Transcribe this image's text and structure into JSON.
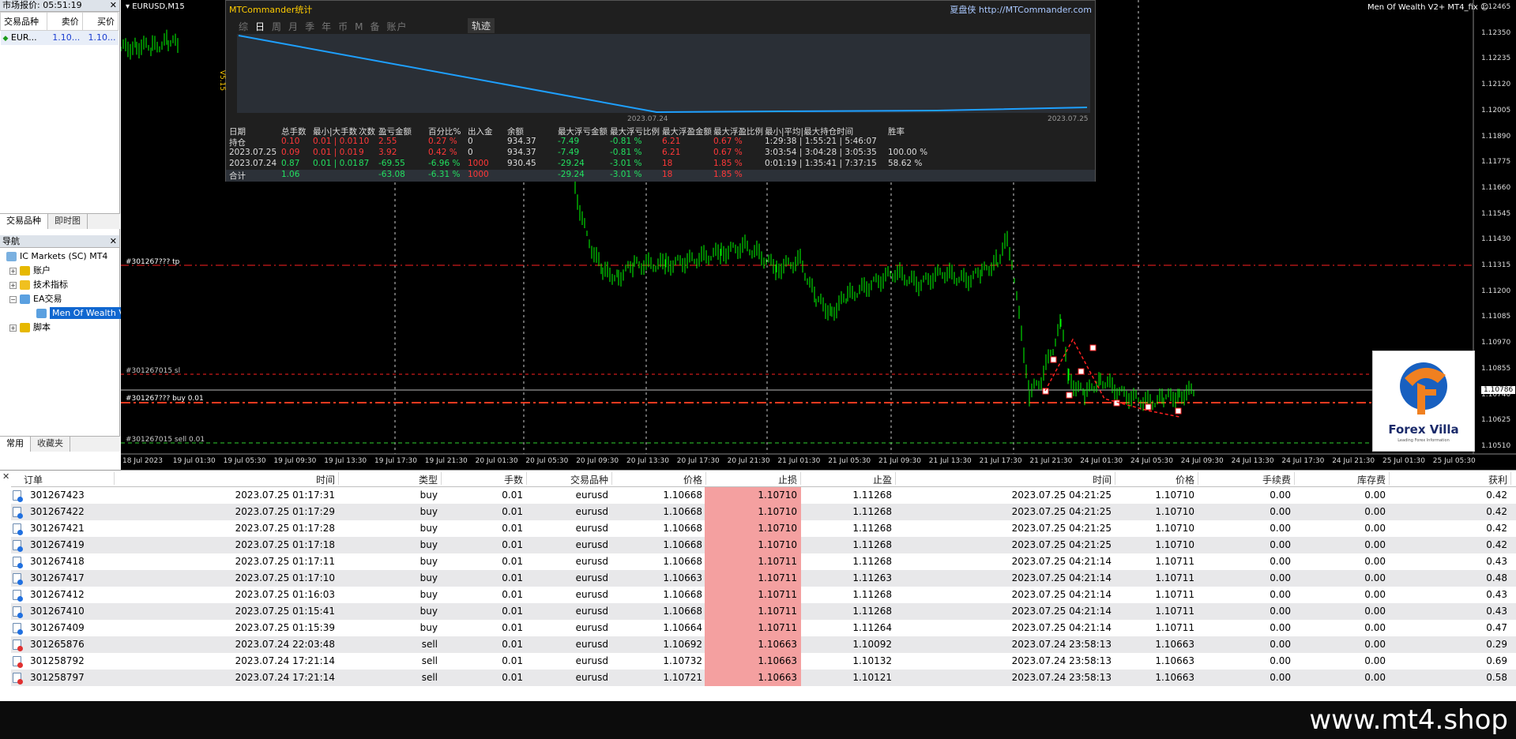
{
  "market_watch": {
    "title": "市场报价: 05:51:19",
    "columns": [
      "交易品种",
      "卖价",
      "买价"
    ],
    "rows": [
      {
        "symbol": "EUR...",
        "bid": "1.10...",
        "ask": "1.10..."
      }
    ],
    "tabs": [
      "交易品种",
      "即时图"
    ]
  },
  "navigator": {
    "title": "导航",
    "items": [
      {
        "label": "IC Markets (SC) MT4"
      },
      {
        "label": "账户"
      },
      {
        "label": "技术指标"
      },
      {
        "label": "EA交易"
      },
      {
        "label": "Men Of Wealth V2"
      },
      {
        "label": "脚本"
      }
    ],
    "tabs": [
      "常用",
      "收藏夹"
    ]
  },
  "chart": {
    "symbol_title": "EURUSD,M15",
    "ea_title": "Men Of Wealth V2+ MT4_fix",
    "line_labels": {
      "tp": "#301267??? tp",
      "sl": "#301267015 sl",
      "buy": "#301267??? buy 0.01",
      "sell": "#301267015 sell 0.01"
    },
    "price_axis": [
      "1.12465",
      "1.12350",
      "1.12235",
      "1.12120",
      "1.12005",
      "1.11890",
      "1.11775",
      "1.11660",
      "1.11545",
      "1.11430",
      "1.11315",
      "1.11200",
      "1.11085",
      "1.10970",
      "1.10855",
      "1.10740",
      "1.10625",
      "1.10510"
    ],
    "current_price": "1.10786",
    "time_axis": [
      "18 Jul 2023",
      "19 Jul 01:30",
      "19 Jul 05:30",
      "19 Jul 09:30",
      "19 Jul 13:30",
      "19 Jul 17:30",
      "19 Jul 21:30",
      "20 Jul 01:30",
      "20 Jul 05:30",
      "20 Jul 09:30",
      "20 Jul 13:30",
      "20 Jul 17:30",
      "20 Jul 21:30",
      "21 Jul 01:30",
      "21 Jul 05:30",
      "21 Jul 09:30",
      "21 Jul 13:30",
      "21 Jul 17:30",
      "21 Jul 21:30",
      "24 Jul 01:30",
      "24 Jul 05:30",
      "24 Jul 09:30",
      "24 Jul 13:30",
      "24 Jul 17:30",
      "24 Jul 21:30",
      "25 Jul 01:30",
      "25 Jul 05:30"
    ]
  },
  "mtc": {
    "title": "MTCommander统计",
    "brand": "夏盘侠 http://MTCommander.com",
    "tabs": [
      "综",
      "日",
      "周",
      "月",
      "季",
      "年",
      "币",
      "M",
      "备",
      "账户"
    ],
    "track": "轨迹",
    "version": "V5.15",
    "date_start": "2023.07.24",
    "date_end": "2023.07.25",
    "headers": [
      "日期",
      "总手数",
      "最小|大手数",
      "次数",
      "盈亏金额",
      "百分比%",
      "出入金",
      "余额",
      "最大浮亏金额",
      "最大浮亏比例",
      "最大浮盈金额",
      "最大浮盈比例",
      "最小|平均|最大持仓时间",
      "胜率"
    ],
    "rows": [
      [
        "持仓",
        "0.10",
        "0.01 | 0.01",
        "10",
        "2.55",
        "0.27 %",
        "0",
        "934.37",
        "-7.49",
        "-0.81 %",
        "6.21",
        "0.67 %",
        "1:29:38 | 1:55:21 | 5:46:07",
        ""
      ],
      [
        "2023.07.25",
        "0.09",
        "0.01 | 0.01",
        "9",
        "3.92",
        "0.42 %",
        "0",
        "934.37",
        "-7.49",
        "-0.81 %",
        "6.21",
        "0.67 %",
        "3:03:54 | 3:04:28 | 3:05:35",
        "100.00 %"
      ],
      [
        "2023.07.24",
        "0.87",
        "0.01 | 0.01",
        "87",
        "-69.55",
        "-6.96 %",
        "1000",
        "930.45",
        "-29.24",
        "-3.01 %",
        "18",
        "1.85 %",
        "0:01:19 | 1:35:41 | 7:37:15",
        "58.62 %"
      ],
      [
        "合计",
        "1.06",
        "",
        "",
        "-63.08",
        "-6.31 %",
        "1000",
        "",
        "-29.24",
        "-3.01 %",
        "18",
        "1.85 %",
        "",
        ""
      ]
    ]
  },
  "terminal": {
    "headers": [
      "订单",
      "时间",
      "类型",
      "手数",
      "交易品种",
      "价格",
      "止损",
      "止盈",
      "时间",
      "价格",
      "手续费",
      "库存费",
      "获利"
    ],
    "rows": [
      [
        "301267423",
        "2023.07.25 01:17:31",
        "buy",
        "0.01",
        "eurusd",
        "1.10668",
        "1.10710",
        "1.11268",
        "2023.07.25 04:21:25",
        "1.10710",
        "0.00",
        "0.00",
        "0.42"
      ],
      [
        "301267422",
        "2023.07.25 01:17:29",
        "buy",
        "0.01",
        "eurusd",
        "1.10668",
        "1.10710",
        "1.11268",
        "2023.07.25 04:21:25",
        "1.10710",
        "0.00",
        "0.00",
        "0.42"
      ],
      [
        "301267421",
        "2023.07.25 01:17:28",
        "buy",
        "0.01",
        "eurusd",
        "1.10668",
        "1.10710",
        "1.11268",
        "2023.07.25 04:21:25",
        "1.10710",
        "0.00",
        "0.00",
        "0.42"
      ],
      [
        "301267419",
        "2023.07.25 01:17:18",
        "buy",
        "0.01",
        "eurusd",
        "1.10668",
        "1.10710",
        "1.11268",
        "2023.07.25 04:21:25",
        "1.10710",
        "0.00",
        "0.00",
        "0.42"
      ],
      [
        "301267418",
        "2023.07.25 01:17:11",
        "buy",
        "0.01",
        "eurusd",
        "1.10668",
        "1.10711",
        "1.11268",
        "2023.07.25 04:21:14",
        "1.10711",
        "0.00",
        "0.00",
        "0.43"
      ],
      [
        "301267417",
        "2023.07.25 01:17:10",
        "buy",
        "0.01",
        "eurusd",
        "1.10663",
        "1.10711",
        "1.11263",
        "2023.07.25 04:21:14",
        "1.10711",
        "0.00",
        "0.00",
        "0.48"
      ],
      [
        "301267412",
        "2023.07.25 01:16:03",
        "buy",
        "0.01",
        "eurusd",
        "1.10668",
        "1.10711",
        "1.11268",
        "2023.07.25 04:21:14",
        "1.10711",
        "0.00",
        "0.00",
        "0.43"
      ],
      [
        "301267410",
        "2023.07.25 01:15:41",
        "buy",
        "0.01",
        "eurusd",
        "1.10668",
        "1.10711",
        "1.11268",
        "2023.07.25 04:21:14",
        "1.10711",
        "0.00",
        "0.00",
        "0.43"
      ],
      [
        "301267409",
        "2023.07.25 01:15:39",
        "buy",
        "0.01",
        "eurusd",
        "1.10664",
        "1.10711",
        "1.11264",
        "2023.07.25 04:21:14",
        "1.10711",
        "0.00",
        "0.00",
        "0.47"
      ],
      [
        "301265876",
        "2023.07.24 22:03:48",
        "sell",
        "0.01",
        "eurusd",
        "1.10692",
        "1.10663",
        "1.10092",
        "2023.07.24 23:58:13",
        "1.10663",
        "0.00",
        "0.00",
        "0.29"
      ],
      [
        "301258792",
        "2023.07.24 17:21:14",
        "sell",
        "0.01",
        "eurusd",
        "1.10732",
        "1.10663",
        "1.10132",
        "2023.07.24 23:58:13",
        "1.10663",
        "0.00",
        "0.00",
        "0.69"
      ],
      [
        "301258797",
        "2023.07.24 17:21:14",
        "sell",
        "0.01",
        "eurusd",
        "1.10721",
        "1.10663",
        "1.10121",
        "2023.07.24 23:58:13",
        "1.10663",
        "0.00",
        "0.00",
        "0.58"
      ]
    ]
  },
  "logo": {
    "text": "Forex Villa",
    "tagline": "Leading Forex Information"
  },
  "watermark": "www.mt4.shop",
  "colors": {
    "candle": "#00ff00",
    "equity_line": "#1ea0ff",
    "sl_bg": "#f4a0a0",
    "tp_line": "#ff2020"
  }
}
